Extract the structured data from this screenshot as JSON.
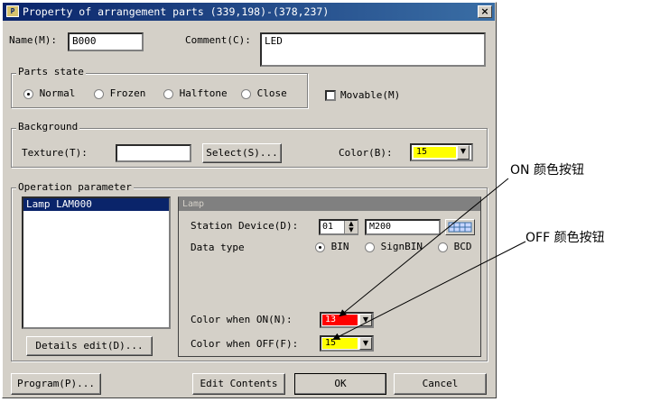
{
  "window": {
    "title": "Property of arrangement parts (339,198)-(378,237)",
    "app_icon_label": "P",
    "close_glyph": "×"
  },
  "name": {
    "label": "Name(M):",
    "value": "B000"
  },
  "comment": {
    "label": "Comment(C):",
    "value": "LED"
  },
  "parts_state": {
    "legend": "Parts state",
    "options": [
      {
        "label": "Normal",
        "selected": true
      },
      {
        "label": "Frozen",
        "selected": false
      },
      {
        "label": "Halftone",
        "selected": false
      },
      {
        "label": "Close",
        "selected": false
      }
    ]
  },
  "movable": {
    "label": "Movable(M)",
    "checked": false
  },
  "background": {
    "legend": "Background",
    "texture_label": "Texture(T):",
    "texture_value": "",
    "select_button": "Select(S)...",
    "color_label": "Color(B):",
    "color_value": "15",
    "color_hex": "#ffff00"
  },
  "operation": {
    "legend": "Operation parameter",
    "list_items": [
      "Lamp LAM000"
    ],
    "details_button": "Details edit(D)..."
  },
  "lamp": {
    "header": "Lamp",
    "station_label": "Station Device(D):",
    "station_value": "01",
    "device_value": "M200",
    "data_type_label": "Data type",
    "data_types": [
      {
        "label": "BIN",
        "selected": true
      },
      {
        "label": "SignBIN",
        "selected": false
      },
      {
        "label": "BCD",
        "selected": false
      }
    ],
    "on_label": "Color when ON(N):",
    "on_value": "13",
    "on_hex": "#ff0000",
    "off_label": "Color when OFF(F):",
    "off_value": "15",
    "off_hex": "#ffff00"
  },
  "footer": {
    "program_button": "Program(P)...",
    "edit_button": "Edit Contents",
    "ok_button": "OK",
    "cancel_button": "Cancel"
  },
  "annotations": {
    "on_button": "ON 颜色按钮",
    "off_button": "OFF 颜色按钮"
  }
}
